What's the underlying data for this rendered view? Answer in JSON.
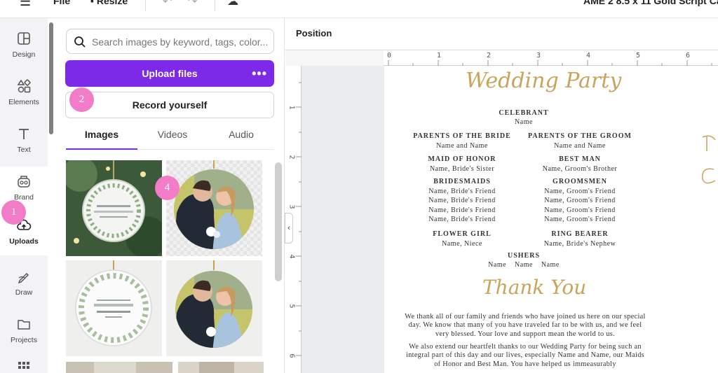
{
  "topbar": {
    "menu_icon": "hamburger-icon",
    "file_label": "File",
    "resize_label": "Resize",
    "document_title": "AME 2 8.5 x 11 Gold Script Ca"
  },
  "rail": {
    "items": [
      {
        "label": "Design",
        "icon": "layout-icon"
      },
      {
        "label": "Elements",
        "icon": "shapes-icon"
      },
      {
        "label": "Text",
        "icon": "text-icon"
      },
      {
        "label": "Brand",
        "icon": "brand-icon"
      },
      {
        "label": "Uploads",
        "icon": "cloud-upload-icon"
      },
      {
        "label": "Draw",
        "icon": "pen-icon"
      },
      {
        "label": "Projects",
        "icon": "folder-icon"
      }
    ]
  },
  "panel": {
    "search_placeholder": "Search images by keyword, tags, color...",
    "upload_label": "Upload files",
    "upload_more": "•••",
    "record_label": "Record yourself",
    "tabs": [
      "Images",
      "Videos",
      "Audio"
    ],
    "markers": [
      "1",
      "2",
      "4"
    ]
  },
  "canvas": {
    "position_label": "Position",
    "ruler_top": [
      "0",
      "1",
      "2",
      "3",
      "4",
      "5",
      "6"
    ],
    "ruler_left": [
      "1",
      "2",
      "3",
      "4",
      "5",
      "6"
    ],
    "collapse_glyph": "‹"
  },
  "program": {
    "title": "Wedding Party",
    "celebrant_heading": "CELEBRANT",
    "celebrant_name": "Name",
    "parents_bride_heading": "PARENTS OF THE BRIDE",
    "parents_bride_names": "Name and Name",
    "parents_groom_heading": "PARENTS OF THE GROOM",
    "parents_groom_names": "Name and Name",
    "maid_heading": "MAID OF HONOR",
    "maid_name": "Name, Bride's Sister",
    "bestman_heading": "BEST MAN",
    "bestman_name": "Name, Groom's Brother",
    "bridesmaids_heading": "BRIDESMAIDS",
    "bridesmaids": [
      "Name, Bride's Friend",
      "Name, Bride's Friend",
      "Name, Bride's Friend",
      "Name, Bride's Friend"
    ],
    "groomsmen_heading": "GROOMSMEN",
    "groomsmen": [
      "Name, Groom's Friend",
      "Name, Groom's Friend",
      "Name, Groom's Friend",
      "Name, Groom's Friend"
    ],
    "flowergirl_heading": "FLOWER GIRL",
    "flowergirl_name": "Name, Niece",
    "ringbearer_heading": "RING BEARER",
    "ringbearer_name": "Name, Bride's Nephew",
    "ushers_heading": "USHERS",
    "ushers_names": "Name    Name    Name",
    "thankyou": "Thank You",
    "para1": "We thank all of our family and friends who have joined us here on our special day. We know that many of you have traveled far to be with us, and we feel very blessed. Your love and support mean the world to us.",
    "para2": "We also extend our heartfelt thanks to our Wedding Party for being such an integral part of this day and our lives, especially Name and Name, our Maids of Honor and Best Man. You have helped us immeasurably"
  },
  "colors": {
    "accent": "#7d2ae8",
    "marker": "#f27cc7",
    "gold": "#c9a45b"
  }
}
